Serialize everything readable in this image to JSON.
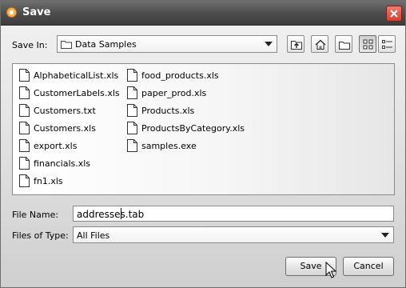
{
  "window": {
    "title": "Save"
  },
  "toolbar": {
    "save_in_label": "Save In:",
    "save_in_value": "Data Samples",
    "buttons": [
      {
        "name": "up-one-level",
        "icon": "folder-up-icon"
      },
      {
        "name": "home",
        "icon": "home-icon"
      },
      {
        "name": "new-folder",
        "icon": "new-folder-icon"
      },
      {
        "name": "list-view",
        "icon": "list-view-icon",
        "pressed": true
      },
      {
        "name": "details-view",
        "icon": "details-view-icon",
        "pressed": false
      }
    ]
  },
  "files": {
    "column1": [
      "AlphabeticalList.xls",
      "CustomerLabels.xls",
      "Customers.txt",
      "Customers.xls",
      "export.xls",
      "financials.xls",
      "fn1.xls"
    ],
    "column2": [
      "food_products.xls",
      "paper_prod.xls",
      "Products.xls",
      "ProductsByCategory.xls",
      "samples.exe"
    ]
  },
  "filename": {
    "label": "File Name:",
    "value": "addresses.tab"
  },
  "filetype": {
    "label": "Files of Type:",
    "value": "All Files"
  },
  "actions": {
    "save_label": "Save",
    "cancel_label": "Cancel"
  },
  "colors": {
    "titlebar": "#4e4e4e",
    "close_button": "#d2402f",
    "window_bg": "#e3e3e3"
  }
}
